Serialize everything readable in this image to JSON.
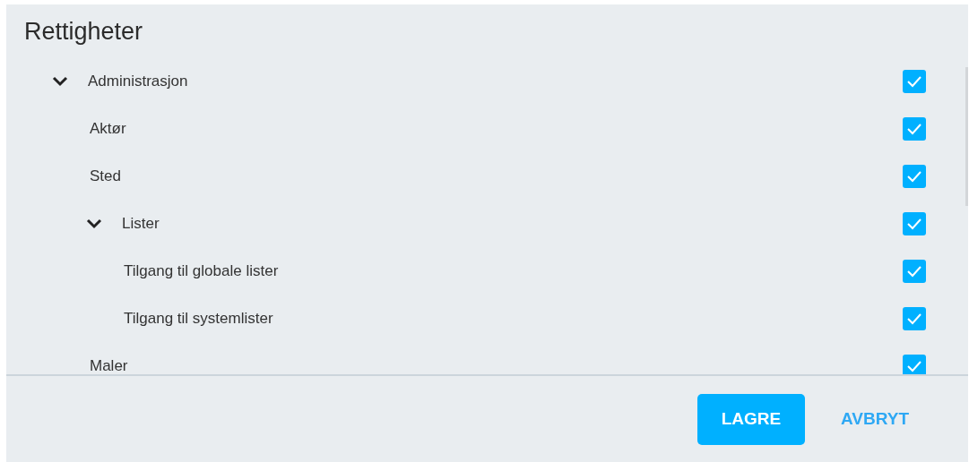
{
  "dialog": {
    "title": "Rettigheter"
  },
  "tree": [
    {
      "label": "Administrasjon",
      "expanded": true,
      "checked": true,
      "children": [
        {
          "label": "Aktør",
          "checked": true
        },
        {
          "label": "Sted",
          "checked": true
        },
        {
          "label": "Lister",
          "expanded": true,
          "checked": true,
          "children": [
            {
              "label": "Tilgang til globale lister",
              "checked": true
            },
            {
              "label": "Tilgang til systemlister",
              "checked": true
            }
          ]
        },
        {
          "label": "Maler",
          "checked": true
        }
      ]
    }
  ],
  "buttons": [
    {
      "label": "LAGRE",
      "kind": "primary"
    },
    {
      "label": "AVBRYT",
      "kind": "text"
    }
  ]
}
